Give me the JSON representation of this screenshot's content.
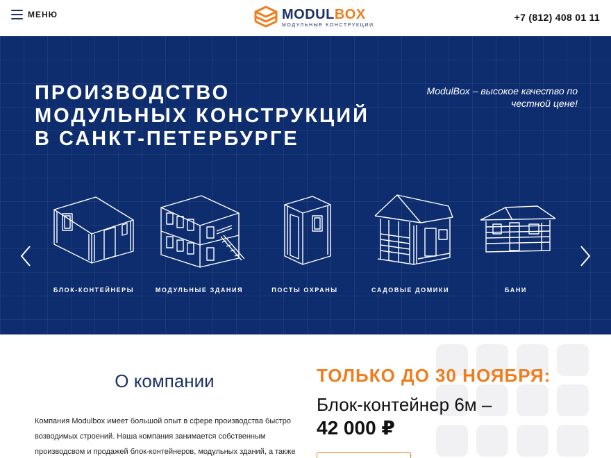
{
  "header": {
    "menu_label": "МЕНЮ",
    "logo_part1": "MODUL",
    "logo_part2": "BOX",
    "logo_subtitle": "МОДУЛЬНЫЕ КОНСТРУКЦИИ",
    "phone": "+7 (812) 408 01 11"
  },
  "hero": {
    "title_lines": [
      "ПРОИЗВОДСТВО",
      "МОДУЛЬНЫХ КОНСТРУКЦИЙ",
      "В САНКТ-ПЕТЕРБУРГЕ"
    ],
    "slogan": "ModulBox – высокое качество по честной цене!",
    "products": [
      {
        "label": "БЛОК-КОНТЕЙНЕРЫ",
        "icon": "block-container-drawing"
      },
      {
        "label": "МОДУЛЬНЫЕ ЗДАНИЯ",
        "icon": "modular-building-drawing"
      },
      {
        "label": "ПОСТЫ ОХРАНЫ",
        "icon": "guard-post-drawing"
      },
      {
        "label": "САДОВЫЕ ДОМИКИ",
        "icon": "garden-house-drawing"
      },
      {
        "label": "БАНИ",
        "icon": "bathhouse-drawing"
      }
    ]
  },
  "about": {
    "title": "О компании",
    "text": "Компания Modulbox имеет большой опыт в сфере производства быстро возводимых строений. Наша компания занимается собственным производсвом и продажей блок-контейнеров, модульных зданий, а также"
  },
  "promo": {
    "headline": "ТОЛЬКО ДО 30 НОЯБРЯ:",
    "product": "Блок-контейнер 6м –",
    "price": "42 000 ₽"
  },
  "colors": {
    "brand_blue": "#1b3266",
    "hero_blue": "#0e2d6e",
    "accent_orange": "#f07d1d"
  }
}
